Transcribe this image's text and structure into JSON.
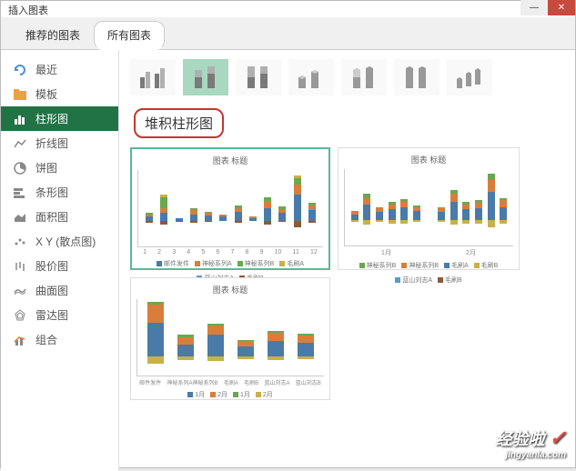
{
  "window": {
    "title": "插入图表"
  },
  "tabs": {
    "recommended": "推荐的图表",
    "all": "所有图表"
  },
  "sidebar": {
    "items": [
      {
        "label": "最近",
        "icon": "recent"
      },
      {
        "label": "模板",
        "icon": "template"
      },
      {
        "label": "柱形图",
        "icon": "column",
        "selected": true
      },
      {
        "label": "折线图",
        "icon": "line"
      },
      {
        "label": "饼图",
        "icon": "pie"
      },
      {
        "label": "条形图",
        "icon": "bar"
      },
      {
        "label": "面积图",
        "icon": "area"
      },
      {
        "label": "X Y (散点图)",
        "icon": "scatter"
      },
      {
        "label": "股价图",
        "icon": "stock"
      },
      {
        "label": "曲面图",
        "icon": "surface"
      },
      {
        "label": "雷达图",
        "icon": "radar"
      },
      {
        "label": "组合",
        "icon": "combo"
      }
    ]
  },
  "subtitle": "堆积柱形图",
  "previews": {
    "title": "图表 标题",
    "legend_series": [
      "邮件发件",
      "神秘系列A",
      "神秘系列B",
      "毛刷A",
      "蓝山刘志A",
      "毛刷B"
    ],
    "legend_months": [
      "1月",
      "2月",
      "1月",
      "2月"
    ]
  },
  "chart_data": [
    {
      "type": "bar",
      "stacked": true,
      "title": "图表 标题",
      "categories": [
        "1",
        "2",
        "3",
        "4",
        "5",
        "6",
        "7",
        "8",
        "9",
        "10",
        "11",
        "12"
      ],
      "ylim": [
        -2000,
        4000
      ],
      "yticks": [
        "4000",
        "3000",
        "2000",
        "1000",
        "0",
        "-1000",
        "-2000"
      ],
      "series": [
        {
          "name": "邮件发件",
          "color": "#4a7aa8",
          "values": [
            300,
            600,
            200,
            500,
            400,
            300,
            700,
            200,
            1000,
            600,
            2000,
            800
          ]
        },
        {
          "name": "神秘系列A",
          "color": "#d97e3a",
          "values": [
            200,
            400,
            0,
            300,
            200,
            200,
            300,
            100,
            500,
            300,
            800,
            400
          ]
        },
        {
          "name": "神秘系列B",
          "color": "#6aa84f",
          "values": [
            100,
            800,
            0,
            200,
            100,
            0,
            200,
            0,
            300,
            200,
            500,
            200
          ]
        },
        {
          "name": "毛刷A",
          "color": "#c9b049",
          "values": [
            0,
            200,
            0,
            0,
            0,
            0,
            0,
            0,
            0,
            0,
            200,
            0
          ]
        },
        {
          "name": "蓝山刘志A",
          "color": "#5a9bc4",
          "values": [
            0,
            0,
            0,
            0,
            0,
            0,
            0,
            0,
            0,
            0,
            0,
            0
          ]
        },
        {
          "name": "毛刷B",
          "color": "#8a5a3a",
          "values": [
            -200,
            -300,
            -100,
            -200,
            -100,
            0,
            -200,
            0,
            -300,
            -100,
            -500,
            -200
          ]
        }
      ]
    },
    {
      "type": "bar",
      "stacked": true,
      "grouped_by_month": true,
      "title": "图表 标题",
      "x_groups": [
        "1月",
        "2月"
      ],
      "categories_per_group": 6,
      "ylim": [
        -2000,
        4000
      ],
      "yticks": [
        "4000",
        "3000",
        "2000",
        "1000",
        "0",
        "-1000",
        "-2000"
      ],
      "series": [
        {
          "name": "神秘系列B",
          "color": "#6aa84f"
        },
        {
          "name": "神秘系列B",
          "color": "#d97e3a"
        },
        {
          "name": "毛刷A",
          "color": "#4a7aa8"
        },
        {
          "name": "毛刷B",
          "color": "#c9b049"
        },
        {
          "name": "蓝山刘志A",
          "color": "#5a9bc4"
        },
        {
          "name": "毛刷B",
          "color": "#8a5a3a"
        }
      ]
    },
    {
      "type": "bar",
      "stacked": true,
      "title": "图表 标题",
      "categories": [
        "邮件发件",
        "神秘系列A神秘系列B",
        "毛刷A",
        "毛刷B",
        "蓝山刘志A",
        "蓝山刘志B"
      ],
      "ylim": [
        -2000,
        6000
      ],
      "yticks": [
        "6000",
        "4000",
        "2000",
        "0",
        "-2000"
      ],
      "series": [
        {
          "name": "1月",
          "color": "#4a7aa8",
          "values": [
            3500,
            1200,
            2200,
            1000,
            1600,
            1400
          ]
        },
        {
          "name": "2月",
          "color": "#d97e3a",
          "values": [
            1800,
            800,
            1000,
            600,
            800,
            700
          ]
        },
        {
          "name": "1月",
          "color": "#6aa84f",
          "values": [
            300,
            200,
            200,
            100,
            200,
            200
          ]
        },
        {
          "name": "2月",
          "color": "#c9b049",
          "values": [
            -800,
            -400,
            -500,
            -300,
            -400,
            -300
          ]
        }
      ]
    }
  ],
  "watermark": {
    "text": "经验啦",
    "sub": "jingyanla.com"
  }
}
